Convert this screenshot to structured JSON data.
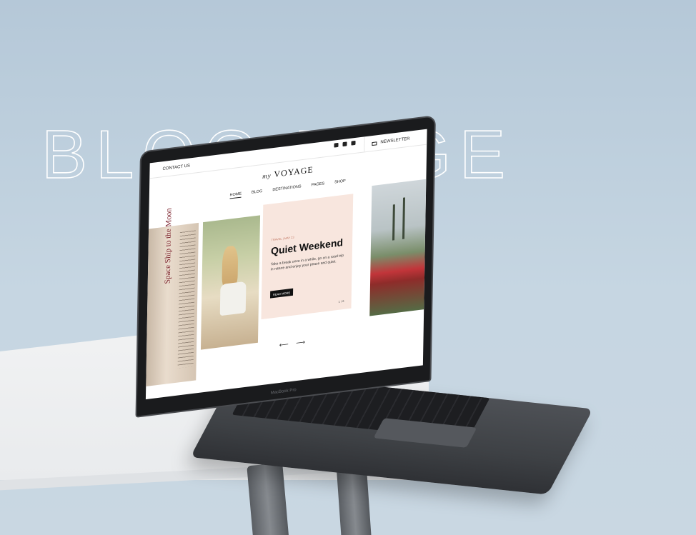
{
  "headline": "BLOG PAGE",
  "laptop": {
    "brand": "MacBook Pro"
  },
  "site": {
    "contact_label": "CONTACT US",
    "newsletter_label": "NEWSLETTER",
    "logo_prefix": "my",
    "logo_name": "VOYAGE",
    "nav": [
      "HOME",
      "BLOG",
      "DESTINATIONS",
      "PAGES",
      "SHOP"
    ],
    "nav_active_index": 0,
    "social_icons": [
      "twitter-icon",
      "instagram-icon",
      "youtube-icon"
    ]
  },
  "hero": {
    "book_title": "Space Ship to the Moon",
    "kicker": "TRAVEL | MAY 23",
    "title": "Quiet Weekend",
    "text": "Take a break once in a while, go on a road trip in nature and enjoy your peace and quiet.",
    "button_label": "READ MORE",
    "pager": "1 / 6",
    "arrows": "⟵ ⟶"
  },
  "colors": {
    "background": "#b8cad8",
    "card_bg": "#f8e6de",
    "button_bg": "#111111"
  }
}
